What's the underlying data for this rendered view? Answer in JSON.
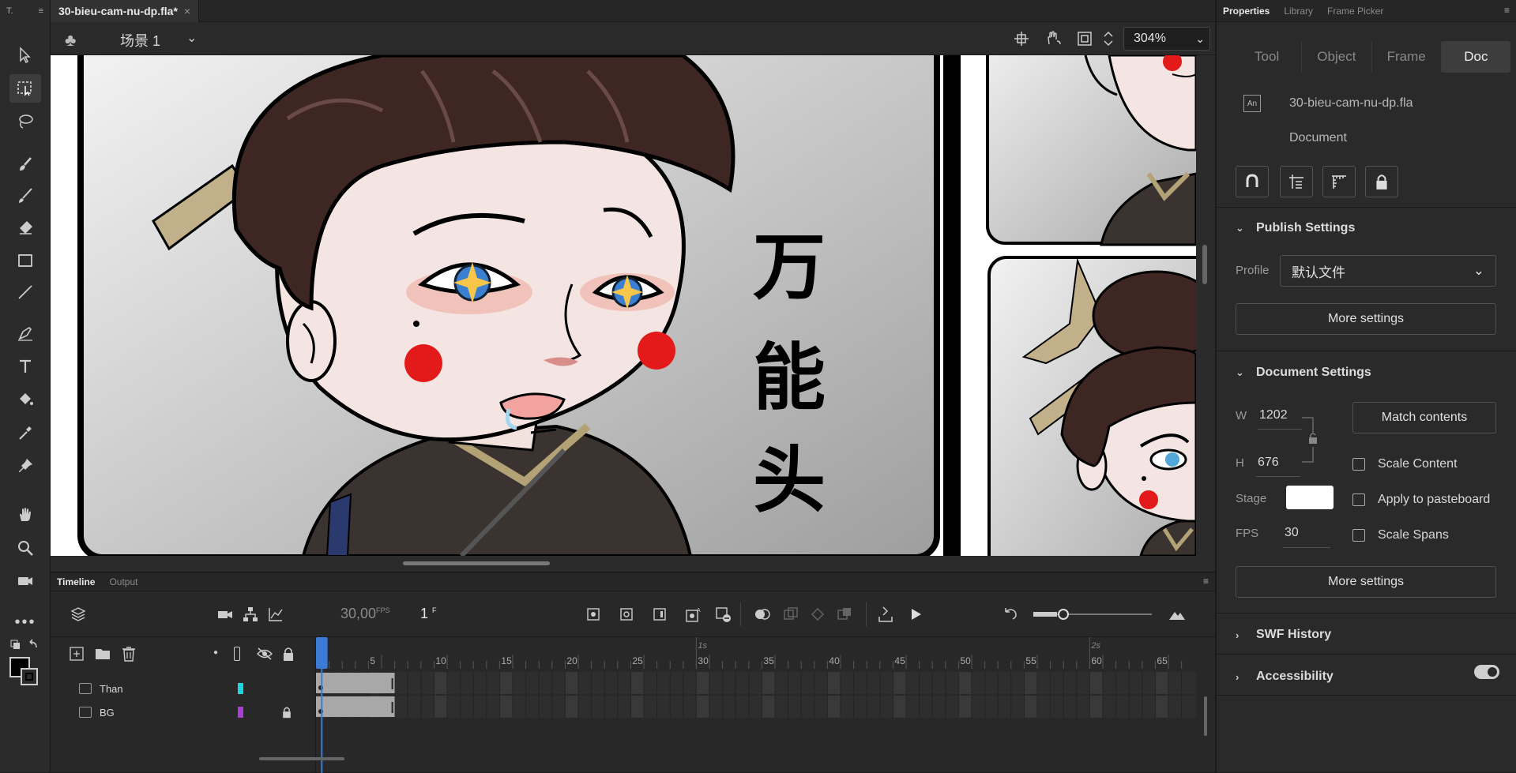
{
  "toolbar": {
    "header_label": "T.",
    "tools": [
      "selection-tool",
      "free-transform-tool",
      "lasso-tool",
      "paint-brush-tool",
      "brush-tool",
      "eraser-tool",
      "rectangle-tool",
      "line-tool",
      "pen-tool",
      "text-tool",
      "paint-bucket-tool",
      "eyedropper-tool",
      "bone-tool",
      "hand-tool",
      "zoom-tool",
      "camera-tool",
      "more-tools"
    ],
    "active_tool": "free-transform-tool",
    "stroke_color": "#000000",
    "fill_color": "#000000"
  },
  "document": {
    "tab_title": "30-bieu-cam-nu-dp.fla*",
    "tab_close": "×",
    "scene_name": "场景 1",
    "zoom": "304%",
    "panel_text": [
      "万",
      "能",
      "头"
    ]
  },
  "timeline": {
    "tabs": [
      "Timeline",
      "Output"
    ],
    "active_tab": "Timeline",
    "fps_value": "30,00",
    "fps_unit": "FPS",
    "frame_value": "1",
    "frame_unit": "F",
    "second_markers": [
      "1s",
      "2s"
    ],
    "frame_numbers": [
      "5",
      "10",
      "15",
      "20",
      "25",
      "30",
      "35",
      "40",
      "45",
      "50",
      "55",
      "60",
      "65"
    ],
    "layers": [
      {
        "name": "Than",
        "color": "#1ed6e0",
        "locked": false
      },
      {
        "name": "BG",
        "color": "#a93fd4",
        "locked": true
      }
    ],
    "playhead_frame": 1,
    "layer_keyframe_span": [
      1,
      6
    ]
  },
  "properties": {
    "tabs": [
      "Properties",
      "Library",
      "Frame Picker"
    ],
    "active_tab": "Properties",
    "segments": [
      "Tool",
      "Object",
      "Frame",
      "Doc"
    ],
    "active_segment": "Doc",
    "file_name": "30-bieu-cam-nu-dp.fla",
    "doc_label": "Document",
    "doc_type_icon_label": "An",
    "publish_settings": {
      "title": "Publish Settings",
      "profile_label": "Profile",
      "profile_value": "默认文件",
      "more_settings": "More settings"
    },
    "document_settings": {
      "title": "Document Settings",
      "w_label": "W",
      "w_value": "1202",
      "h_label": "H",
      "h_value": "676",
      "match_contents": "Match contents",
      "scale_content": "Scale Content",
      "apply_to_pasteboard": "Apply to pasteboard",
      "scale_spans": "Scale Spans",
      "stage_label": "Stage",
      "stage_color": "#ffffff",
      "fps_label": "FPS",
      "fps_value": "30",
      "more_settings": "More settings"
    },
    "swf_history": "SWF History",
    "accessibility": "Accessibility",
    "accessibility_enabled": true
  }
}
